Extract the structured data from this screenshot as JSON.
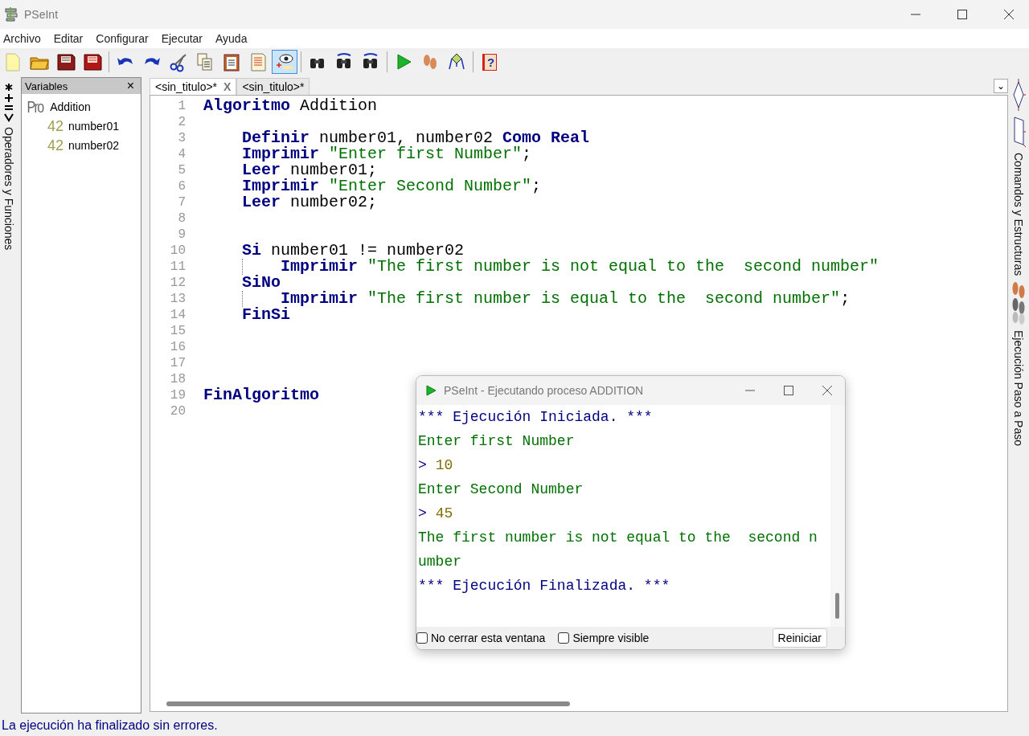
{
  "window": {
    "title": "PSeInt"
  },
  "menu": [
    "Archivo",
    "Editar",
    "Configurar",
    "Ejecutar",
    "Ayuda"
  ],
  "toolbar": [
    {
      "kind": "new",
      "pressed": false
    },
    {
      "kind": "open",
      "pressed": false
    },
    {
      "kind": "save",
      "pressed": false
    },
    {
      "kind": "save-as",
      "pressed": false
    },
    {
      "kind": "separator"
    },
    {
      "kind": "undo",
      "pressed": false
    },
    {
      "kind": "redo",
      "pressed": false
    },
    {
      "kind": "cut",
      "pressed": false
    },
    {
      "kind": "copy",
      "pressed": false
    },
    {
      "kind": "paste",
      "pressed": false
    },
    {
      "kind": "document",
      "pressed": false
    },
    {
      "kind": "watch",
      "pressed": true
    },
    {
      "kind": "separator"
    },
    {
      "kind": "find",
      "pressed": false
    },
    {
      "kind": "find-prev",
      "pressed": false
    },
    {
      "kind": "find-next",
      "pressed": false
    },
    {
      "kind": "separator"
    },
    {
      "kind": "run",
      "pressed": false
    },
    {
      "kind": "step",
      "pressed": false
    },
    {
      "kind": "flowchart",
      "pressed": false
    },
    {
      "kind": "separator"
    },
    {
      "kind": "help",
      "pressed": false,
      "glyph": "?"
    }
  ],
  "left_sidebar": {
    "label": "Operadores y Funciones"
  },
  "variables_panel": {
    "title": "Variables",
    "close": "×",
    "tree": [
      {
        "icon": "Pro",
        "label": "Addition",
        "children": [
          {
            "icon": "42",
            "label": "number01"
          },
          {
            "icon": "42",
            "label": "number02"
          }
        ]
      }
    ]
  },
  "editor": {
    "tabs": [
      {
        "label": "<sin_titulo>*",
        "selected": true,
        "close": "X"
      },
      {
        "label": "<sin_titulo>*",
        "selected": false
      }
    ],
    "dropdown": "⌄",
    "lines": [
      {
        "number": "1",
        "tokens": [
          {
            "kind": "keyword",
            "text": "Algoritmo"
          },
          {
            "kind": "plain",
            "text": " Addition"
          }
        ],
        "children": [
          {
            "number": "2"
          },
          {
            "number": "3",
            "tokens": [
              {
                "kind": "keyword",
                "text": "Definir"
              },
              {
                "kind": "plain",
                "text": " number01, number02 "
              },
              {
                "kind": "keyword",
                "text": "Como Real"
              }
            ]
          },
          {
            "number": "4",
            "tokens": [
              {
                "kind": "keyword",
                "text": "Imprimir"
              },
              {
                "kind": "string",
                "text": " \"Enter first Number\""
              },
              {
                "kind": "plain",
                "text": ";"
              }
            ]
          },
          {
            "number": "5",
            "tokens": [
              {
                "kind": "keyword",
                "text": "Leer"
              },
              {
                "kind": "plain",
                "text": " number01;"
              }
            ]
          },
          {
            "number": "6",
            "tokens": [
              {
                "kind": "keyword",
                "text": "Imprimir"
              },
              {
                "kind": "string",
                "text": " \"Enter Second Number\""
              },
              {
                "kind": "plain",
                "text": ";"
              }
            ]
          },
          {
            "number": "7",
            "tokens": [
              {
                "kind": "keyword",
                "text": "Leer"
              },
              {
                "kind": "plain",
                "text": " number02;"
              }
            ]
          },
          {
            "number": "8"
          },
          {
            "number": "9"
          },
          {
            "number": "10",
            "tokens": [
              {
                "kind": "keyword",
                "text": "Si"
              },
              {
                "kind": "plain",
                "text": " number01 != number02"
              }
            ],
            "children": [
              {
                "number": "11",
                "tokens": [
                  {
                    "kind": "keyword",
                    "text": "Imprimir"
                  },
                  {
                    "kind": "string",
                    "text": " \"The first number is not equal to the  second number\""
                  }
                ]
              }
            ]
          },
          {
            "number": "12",
            "tokens": [
              {
                "kind": "keyword",
                "text": "SiNo"
              }
            ],
            "children": [
              {
                "number": "13",
                "tokens": [
                  {
                    "kind": "keyword",
                    "text": "Imprimir"
                  },
                  {
                    "kind": "string",
                    "text": " \"The first number is equal to the  second number\""
                  },
                  {
                    "kind": "plain",
                    "text": ";"
                  }
                ]
              }
            ]
          },
          {
            "number": "14",
            "tokens": [
              {
                "kind": "keyword",
                "text": "FinSi"
              }
            ]
          },
          {
            "number": "15"
          },
          {
            "number": "16"
          },
          {
            "number": "17"
          },
          {
            "number": "18"
          }
        ]
      },
      {
        "number": "19",
        "tokens": [
          {
            "kind": "keyword",
            "text": "FinAlgoritmo"
          }
        ]
      },
      {
        "number": "20"
      }
    ]
  },
  "right_sidebar": {
    "tabs": [
      "Comandos y Estructuras",
      "Ejecución Paso a Paso"
    ]
  },
  "console": {
    "title": "PSeInt - Ejecutando proceso ADDITION",
    "lines": [
      {
        "kind": "info",
        "text": "*** Ejecución Iniciada. ***"
      },
      {
        "kind": "output",
        "text": "Enter first Number"
      },
      {
        "kind": "input",
        "prompt": ">",
        "text": "10"
      },
      {
        "kind": "output",
        "text": "Enter Second Number"
      },
      {
        "kind": "input",
        "prompt": ">",
        "text": "45"
      },
      {
        "kind": "output",
        "text": "The first number is not equal to the  second n"
      },
      {
        "kind": "output",
        "text": "umber"
      },
      {
        "kind": "info",
        "text": "*** Ejecución Finalizada. ***"
      }
    ],
    "options": [
      {
        "label": "No cerrar esta ventana",
        "checked": false
      },
      {
        "label": "Siempre visible",
        "checked": false
      }
    ],
    "button": "Reiniciar"
  },
  "status_bar": "La ejecución ha finalizado sin errores."
}
